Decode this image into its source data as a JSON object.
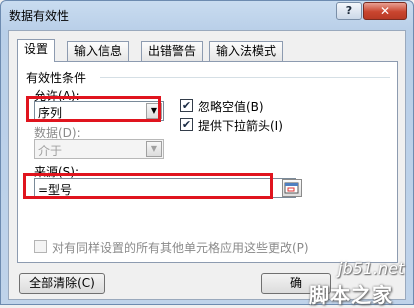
{
  "window": {
    "title": "数据有效性",
    "help_label": "?",
    "close_label": "✕"
  },
  "tabs": [
    {
      "label": "设置",
      "active": true
    },
    {
      "label": "输入信息",
      "active": false
    },
    {
      "label": "出错警告",
      "active": false
    },
    {
      "label": "输入法模式",
      "active": false
    }
  ],
  "validation": {
    "section_title": "有效性条件",
    "allow_label": "允许(A):",
    "allow_value": "序列",
    "ignore_blank_label": "忽略空值(B)",
    "ignore_blank_checked": true,
    "in_cell_dropdown_label": "提供下拉箭头(I)",
    "in_cell_dropdown_checked": true,
    "data_label": "数据(D):",
    "data_value": "介于",
    "source_label": "来源(S):",
    "source_value": "=型号",
    "apply_all_label": "对有同样设置的所有其他单元格应用这些更改(P)",
    "apply_all_checked": false
  },
  "footer": {
    "clear_all_label": "全部清除(C)",
    "ok_label": "确"
  },
  "watermark": {
    "domain": "jb51.net",
    "name": "脚本之家"
  },
  "colors": {
    "highlight": "#e0141e",
    "close_button": "#c9452f",
    "titlebar": "#bfd3ea"
  },
  "icons": {
    "dropdown": "chevron-down-icon",
    "checkmark": "checkmark-icon",
    "collapse_dialog": "range-select-icon",
    "help": "help-icon",
    "close": "close-icon"
  }
}
